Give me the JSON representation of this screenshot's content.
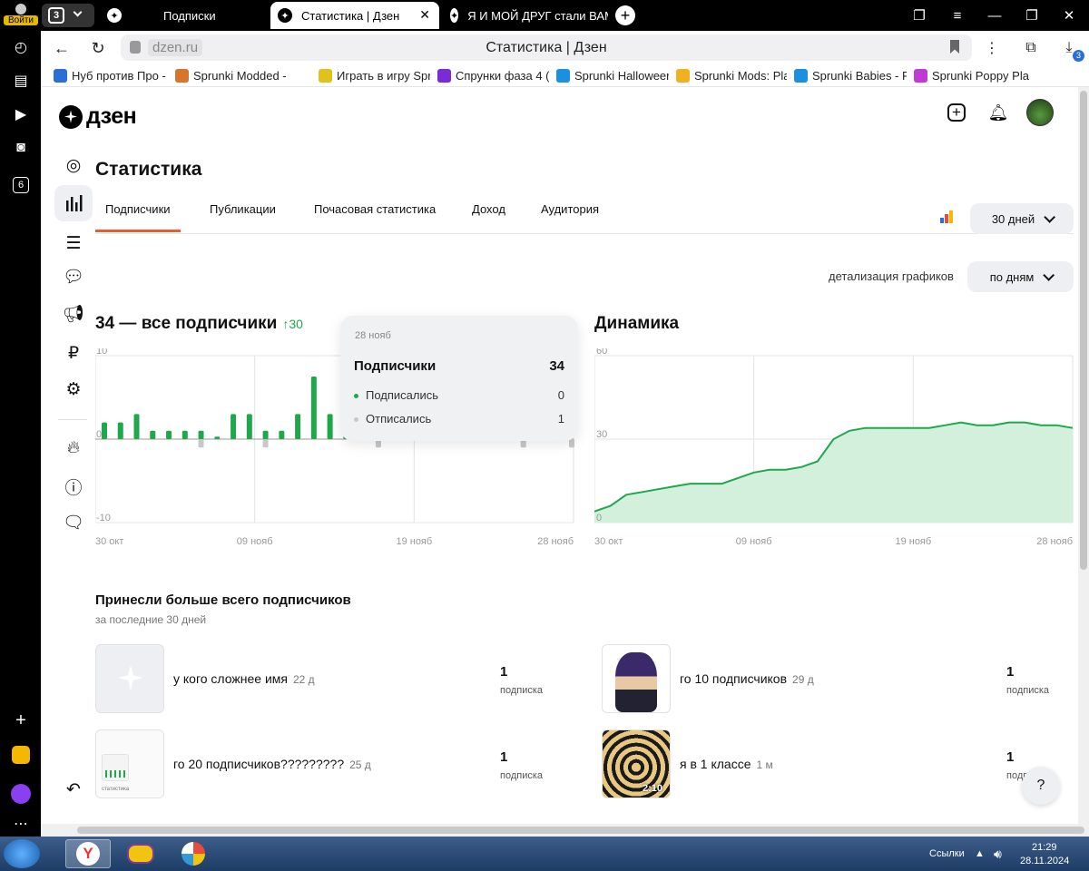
{
  "browser": {
    "login_label": "Войти",
    "tab_count": "3",
    "tabs": [
      {
        "label": "Подписки"
      },
      {
        "label": "Статистика | Дзен"
      },
      {
        "label": "Я И МОЙ ДРУГ стали ВАМ"
      }
    ],
    "domain": "dzen.ru",
    "page_title": "Статистика | Дзен",
    "download_badge": "3",
    "sidebar_badge": "6",
    "bookmarks": [
      {
        "label": "Нуб против Про -",
        "color": "#2b6fd6"
      },
      {
        "label": "Sprunki Modded -",
        "color": "#d6752b"
      },
      {
        "label": "Играть в игру Spr",
        "color": "#e0c21b"
      },
      {
        "label": "Спрунки фаза 4 (с",
        "color": "#7a2bd6"
      },
      {
        "label": "Sprunki Halloween",
        "color": "#1b8fe0"
      },
      {
        "label": "Sprunki Mods: Pla",
        "color": "#f0b020"
      },
      {
        "label": "Sprunki Babies - P",
        "color": "#1b8fe0"
      },
      {
        "label": "Sprunki Poppy Pla",
        "color": "#c03ad6"
      }
    ]
  },
  "header": {
    "logo_text": "дзен"
  },
  "stats": {
    "title": "Статистика",
    "tabs": [
      {
        "label": "Подписчики",
        "active": true
      },
      {
        "label": "Публикации"
      },
      {
        "label": "Почасовая статистика"
      },
      {
        "label": "Доход"
      },
      {
        "label": "Аудитория"
      }
    ],
    "period_label": "30 дней",
    "detail_label": "детализация графиков",
    "detail_value": "по дням"
  },
  "subscribers_chart": {
    "title": "34 — все подписчики",
    "delta": "↑30"
  },
  "dynamics_chart": {
    "title": "Динамика"
  },
  "tooltip": {
    "date": "28 нояб",
    "total_label": "Подписчики",
    "total_value": "34",
    "rows": [
      {
        "label": "Подписались",
        "value": "0",
        "color": "#1fa84b"
      },
      {
        "label": "Отписались",
        "value": "1",
        "color": "#c8c8c8"
      }
    ]
  },
  "chart_data": [
    {
      "type": "bar",
      "title": "34 — все подписчики",
      "x_ticks": [
        "30 окт",
        "09 нояб",
        "19 нояб",
        "28 нояб"
      ],
      "y_ticks": [
        "10",
        "0",
        "-10"
      ],
      "ylim": [
        -10,
        10
      ],
      "series": [
        {
          "name": "Подписались",
          "color": "#1fa84b",
          "values": [
            2,
            2,
            3,
            1,
            1,
            1,
            1,
            0.3,
            3,
            3,
            1,
            1,
            3,
            7.5,
            3,
            1,
            0.4,
            1,
            0.4,
            0.4,
            1,
            1,
            0.4,
            0.4,
            1,
            0.4,
            0.4,
            0.4,
            0.4,
            0
          ]
        },
        {
          "name": "Отписались",
          "color": "#c8c8c8",
          "values": [
            0,
            0,
            0,
            0,
            0,
            0,
            -1,
            0,
            0,
            0,
            -1,
            0,
            0,
            0,
            0,
            0,
            0,
            -1,
            0,
            0,
            0,
            0,
            0,
            0,
            0,
            0,
            -1,
            0,
            0,
            -1
          ]
        }
      ]
    },
    {
      "type": "area",
      "title": "Динамика",
      "x_ticks": [
        "30 окт",
        "09 нояб",
        "19 нояб",
        "28 нояб"
      ],
      "y_ticks": [
        "60",
        "30",
        "0"
      ],
      "ylim": [
        0,
        60
      ],
      "color": "#1fa84b",
      "fill": "#d3f0dc",
      "values": [
        4,
        6,
        10,
        11,
        12,
        13,
        14,
        14,
        14,
        16,
        18,
        19,
        19,
        20,
        22,
        30,
        33,
        34,
        34,
        34,
        34,
        34,
        35,
        36,
        35,
        35,
        36,
        36,
        35,
        35,
        34
      ]
    }
  ],
  "top_publications": {
    "title": "Принесли больше всего подписчиков",
    "subtitle": "за последние 30 дней",
    "items": [
      {
        "title": "у кого сложнее имя",
        "age": "22 д",
        "count": "1",
        "count_label": "подписка"
      },
      {
        "title": "го 10 подписчиков",
        "age": "29 д",
        "count": "1",
        "count_label": "подписка"
      },
      {
        "title": "го 20 подписчиков?????????",
        "age": "25 д",
        "count": "1",
        "count_label": "подписка"
      },
      {
        "title": "я в 1 классе",
        "age": "1 м",
        "count": "1",
        "count_label": "подписка"
      }
    ],
    "video_duration": "2:10",
    "preview_label": "статистика"
  },
  "help_label": "?",
  "taskbar": {
    "lang": "Ссылки",
    "time": "21:29",
    "date": "28.11.2024"
  }
}
